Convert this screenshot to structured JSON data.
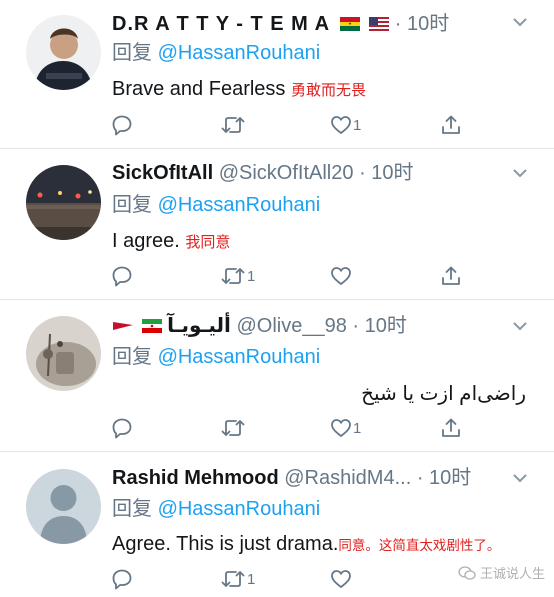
{
  "reply_label": "回复",
  "tweets": [
    {
      "name": "D.R A T T Y - T E M A",
      "handle": "",
      "time": "10时",
      "flags": [
        "ghana-flag-icon",
        "usa-flag-icon"
      ],
      "reply_to": "@HassanRouhani",
      "text": "Brave and Fearless",
      "translation": "勇敢而无畏",
      "reply_count": "",
      "retweet_count": "",
      "like_count": "1"
    },
    {
      "name": "SickOfItAll",
      "handle": "@SickOfItAll20",
      "time": "10时",
      "flags": [],
      "reply_to": "@HassanRouhani",
      "text": "I agree.",
      "translation": "我同意",
      "reply_count": "",
      "retweet_count": "1",
      "like_count": ""
    },
    {
      "name": "أليـويـآ",
      "handle": "@Olive__98",
      "time": "10时",
      "flags": [
        "red-flag-icon",
        "iran-flag-icon"
      ],
      "reply_to": "@HassanRouhani",
      "text": "راضی‌ام ازت یا شیخ",
      "translation": "",
      "reply_count": "",
      "retweet_count": "",
      "like_count": "1"
    },
    {
      "name": "Rashid Mehmood",
      "handle": "@RashidM4...",
      "time": "10时",
      "flags": [],
      "reply_to": "@HassanRouhani",
      "text": "Agree. This is just drama.",
      "translation": "同意。这简直太戏剧性了。",
      "reply_count": "",
      "retweet_count": "1",
      "like_count": ""
    }
  ],
  "separator": "·",
  "watermark": "王诚说人生",
  "colors": {
    "link": "#1da1f2",
    "muted": "#657786",
    "translation": "#e0201f"
  }
}
